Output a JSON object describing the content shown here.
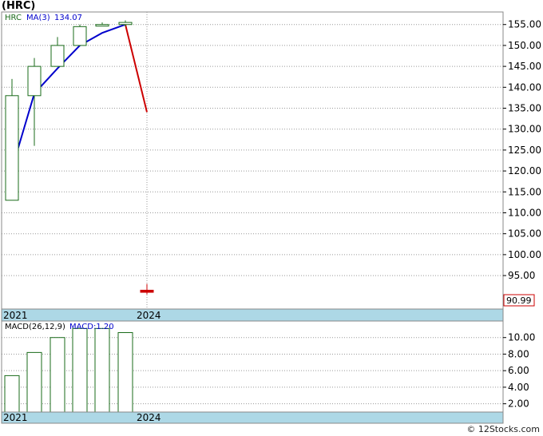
{
  "title": "(HRC)",
  "footer": "© 12Stocks.com",
  "colors": {
    "up": "#1a6b1a",
    "down": "#cc0000",
    "ma": "#0000cc",
    "axisband": "#add8e6",
    "grid": "#999999"
  },
  "chart_data": [
    {
      "type": "candlestick",
      "legend": {
        "symbol": "HRC",
        "ma_label": "MA(3)",
        "ma_value": "134.07"
      },
      "ylim": [
        87,
        158
      ],
      "yticks": [
        "95.00",
        "100.00",
        "105.00",
        "110.00",
        "115.00",
        "120.00",
        "125.00",
        "130.00",
        "135.00",
        "140.00",
        "145.00",
        "150.00",
        "155.00"
      ],
      "x_tick_labels": [
        "2021",
        "2024"
      ],
      "candles": [
        {
          "open": 113,
          "high": 142,
          "low": 113,
          "close": 138
        },
        {
          "open": 138,
          "high": 147,
          "low": 126,
          "close": 145
        },
        {
          "open": 145,
          "high": 152,
          "low": 145,
          "close": 150
        },
        {
          "open": 150,
          "high": 155,
          "low": 150,
          "close": 154.5
        },
        {
          "open": 155,
          "high": 155.5,
          "low": 154.8,
          "close": 155
        },
        {
          "open": 155,
          "high": 156,
          "low": 154.5,
          "close": 155.5
        },
        {
          "open": 91.5,
          "high": 93,
          "low": 90.5,
          "close": 91
        }
      ],
      "ma_values": [
        120.5,
        138.5,
        144.5,
        150,
        153,
        155,
        134.07
      ],
      "last_price": "90.99"
    },
    {
      "type": "bar",
      "legend": {
        "label": "MACD(26,12,9)",
        "value_label": "MACD:1.20"
      },
      "ylim": [
        1,
        12
      ],
      "yticks": [
        "2.00",
        "4.00",
        "6.00",
        "8.00",
        "10.00"
      ],
      "x_tick_labels": [
        "2021",
        "2024"
      ],
      "values": [
        5.4,
        8.2,
        10,
        11.1,
        11.1,
        10.6
      ]
    }
  ]
}
